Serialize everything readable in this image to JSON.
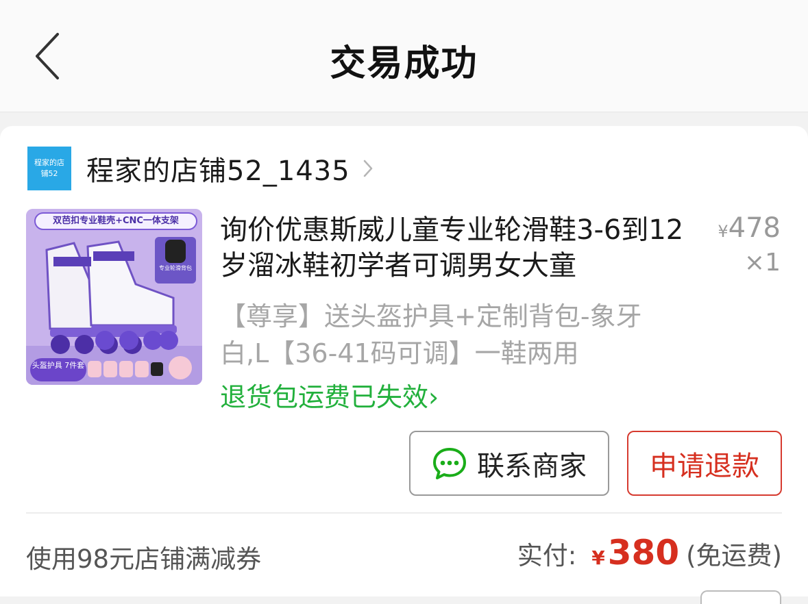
{
  "header": {
    "title": "交易成功"
  },
  "shop": {
    "logo_text": "程家的店铺52",
    "name": "程家的店铺52_1435"
  },
  "product": {
    "image_banner": "双芭扣专业鞋壳+CNC一体支架",
    "image_bag_label": "专业轮滑背包",
    "image_guard_label": "头盔护具 7件套",
    "title": "询价优惠斯威儿童专业轮滑鞋3-6到12岁溜冰鞋初学者可调男女大童",
    "currency": "¥",
    "price": "478",
    "quantity": "×1",
    "spec": "【尊享】送头盔护具+定制背包-象牙白,L【36-41码可调】一鞋两用",
    "return_note": "退货包运费已失效"
  },
  "actions": {
    "contact_label": "联系商家",
    "refund_label": "申请退款"
  },
  "summary": {
    "coupon_text": "使用98元店铺满减券",
    "paid_label": "实付:",
    "currency": "¥",
    "paid_amount": "380",
    "shipping_note": "(免运费)"
  },
  "colors": {
    "accent_red": "#d62f1f",
    "accent_green": "#22b03c",
    "shop_logo_bg": "#29a8e6",
    "product_image_bg": "#cbb6ee"
  },
  "icons": {
    "back": "chevron-left-icon",
    "shop": "chevron-right-icon",
    "contact": "chat-bubble-icon"
  }
}
